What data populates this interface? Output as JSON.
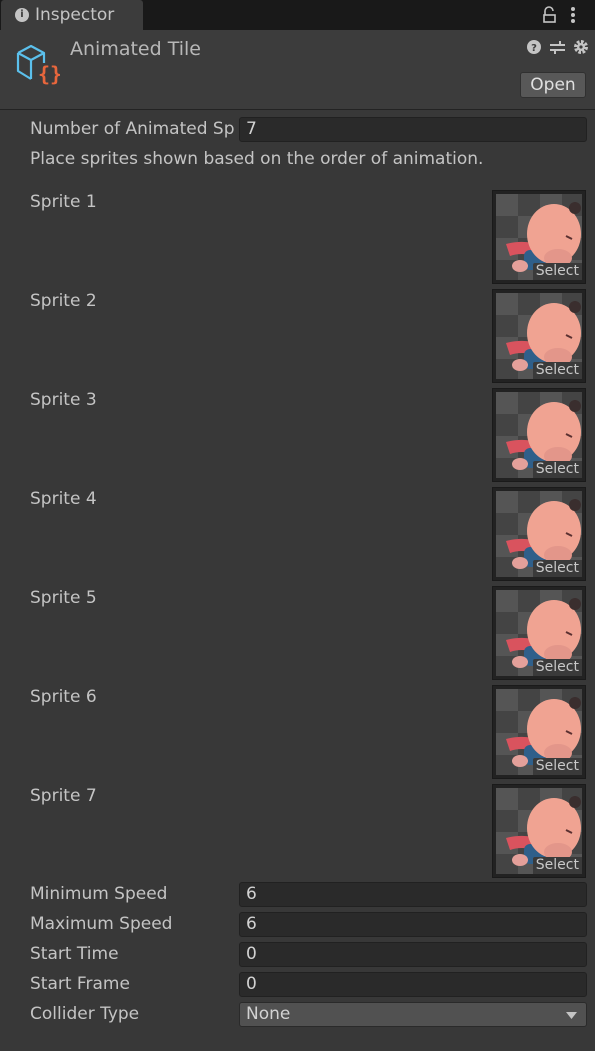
{
  "tab": {
    "label": "Inspector",
    "icon": "info-icon"
  },
  "header": {
    "title": "Animated Tile",
    "open_label": "Open",
    "icons": [
      "help-icon",
      "sliders-icon",
      "gear-icon"
    ]
  },
  "fields": {
    "num_label": "Number of Animated Sp",
    "num_value": "7",
    "help": "Place sprites shown based on the order of animation.",
    "sprites": [
      {
        "label": "Sprite 1"
      },
      {
        "label": "Sprite 2"
      },
      {
        "label": "Sprite 3"
      },
      {
        "label": "Sprite 4"
      },
      {
        "label": "Sprite 5"
      },
      {
        "label": "Sprite 6"
      },
      {
        "label": "Sprite 7"
      }
    ],
    "select_label": "Select",
    "min_label": "Minimum Speed",
    "min_value": "6",
    "max_label": "Maximum Speed",
    "max_value": "6",
    "start_time_label": "Start Time",
    "start_time_value": "0",
    "start_frame_label": "Start Frame",
    "start_frame_value": "0",
    "collider_label": "Collider Type",
    "collider_value": "None"
  }
}
